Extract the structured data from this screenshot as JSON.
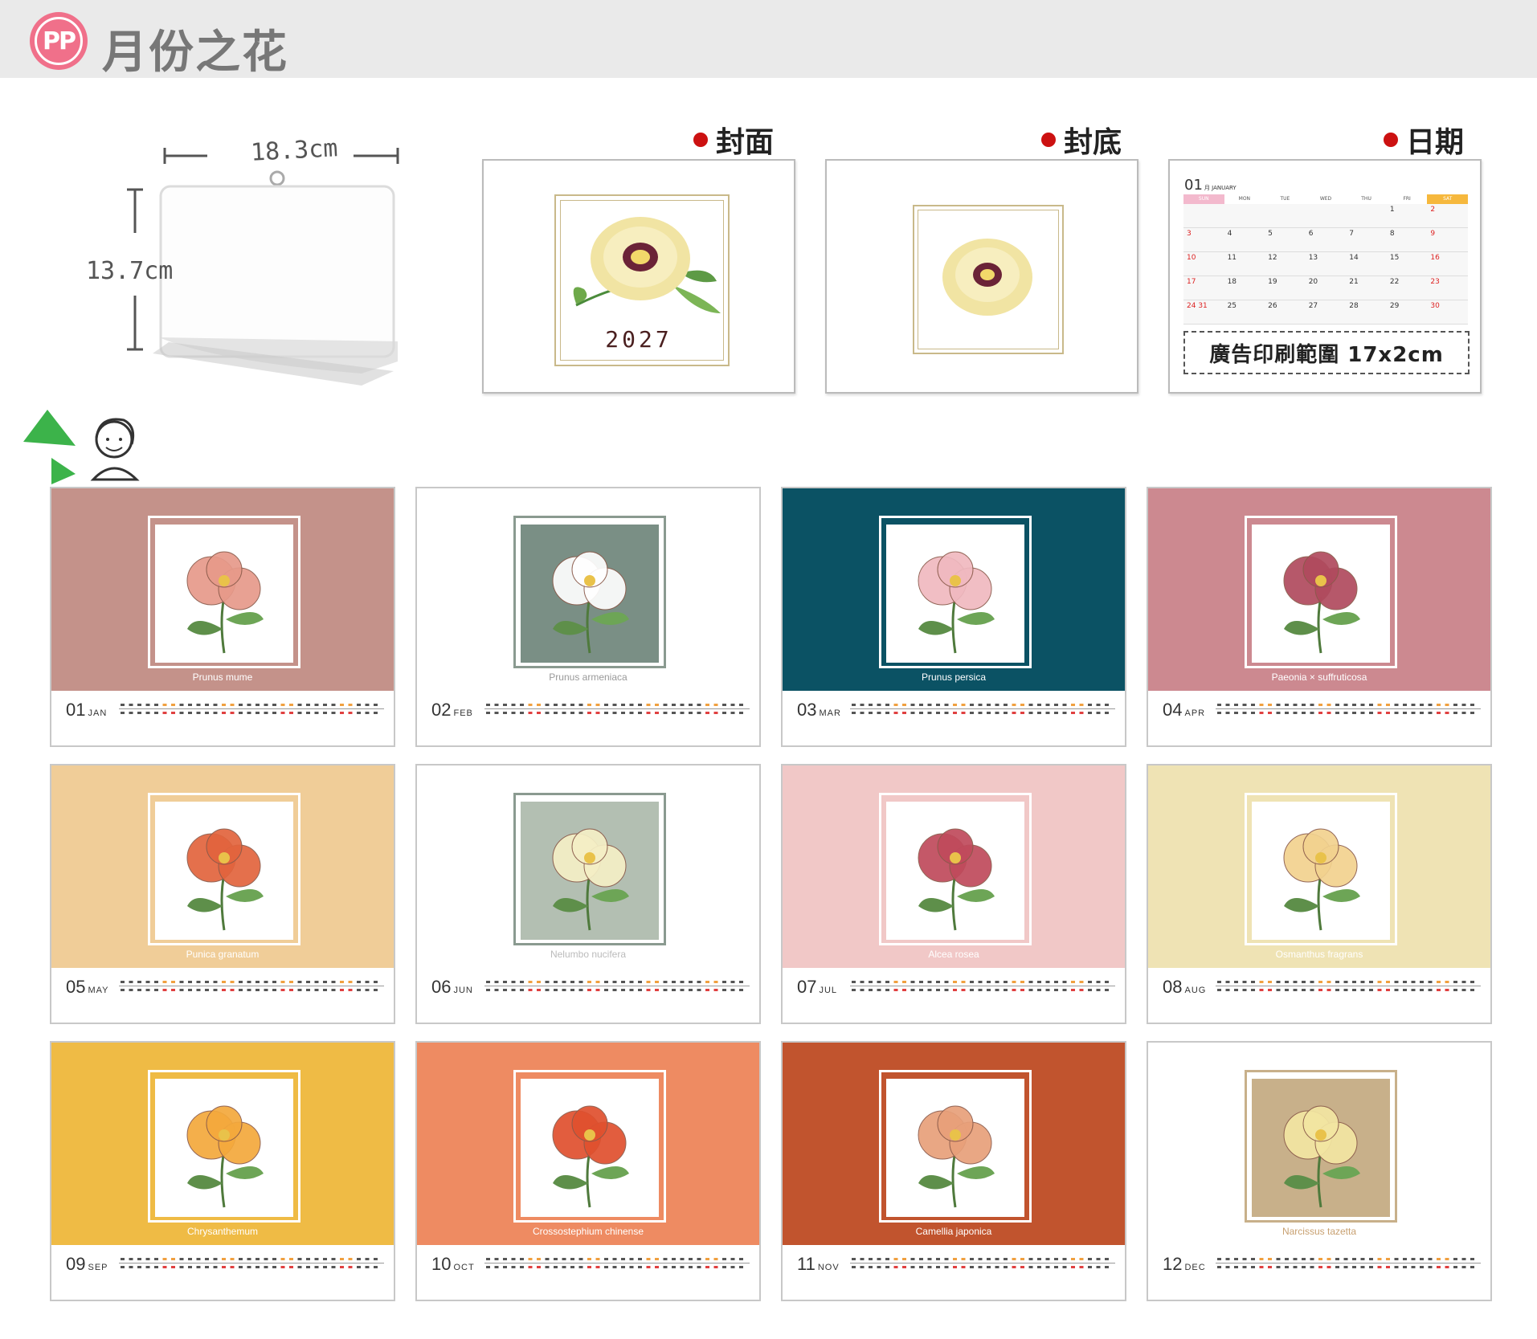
{
  "header": {
    "logo_text": "PP",
    "title": "月份之花"
  },
  "dimensions": {
    "width_label": "18.3cm",
    "height_label": "13.7cm"
  },
  "samples": {
    "cover_label": "封面",
    "back_label": "封底",
    "date_label": "日期",
    "cover_year": "2027",
    "date_sample": {
      "month_num": "01",
      "month_en": "月 JANUARY",
      "weekdays": [
        "SUN",
        "MON",
        "TUE",
        "WED",
        "THU",
        "FRI",
        "SAT"
      ],
      "days": [
        "",
        "",
        "",
        "",
        "",
        "1",
        "2",
        "3",
        "4",
        "5",
        "6",
        "7",
        "8",
        "9",
        "10",
        "11",
        "12",
        "13",
        "14",
        "15",
        "16",
        "17",
        "18",
        "19",
        "20",
        "21",
        "22",
        "23",
        "24 31",
        "25",
        "26",
        "27",
        "28",
        "29",
        "30"
      ],
      "ad_text": "廣告印刷範圍 17x2cm"
    }
  },
  "months": [
    {
      "num": "01",
      "abbr": "JAN",
      "flower": "Prunus mume",
      "bg": "#c4928a"
    },
    {
      "num": "02",
      "abbr": "FEB",
      "flower": "Prunus armeniaca",
      "bg": "#ffffff"
    },
    {
      "num": "03",
      "abbr": "MAR",
      "flower": "Prunus persica",
      "bg": "#0b5264"
    },
    {
      "num": "04",
      "abbr": "APR",
      "flower": "Paeonia × suffruticosa",
      "bg": "#cc8990"
    },
    {
      "num": "05",
      "abbr": "MAY",
      "flower": "Punica granatum",
      "bg": "#f0cd98"
    },
    {
      "num": "06",
      "abbr": "JUN",
      "flower": "Nelumbo nucifera",
      "bg": "#ffffff"
    },
    {
      "num": "07",
      "abbr": "JUL",
      "flower": "Alcea rosea",
      "bg": "#f1c8c7"
    },
    {
      "num": "08",
      "abbr": "AUG",
      "flower": "Osmanthus fragrans",
      "bg": "#efe3b4"
    },
    {
      "num": "09",
      "abbr": "SEP",
      "flower": "Chrysanthemum",
      "bg": "#efbb45"
    },
    {
      "num": "10",
      "abbr": "OCT",
      "flower": "Crossostephium chinense",
      "bg": "#ee8b62"
    },
    {
      "num": "11",
      "abbr": "NOV",
      "flower": "Camellia japonica",
      "bg": "#c1542e"
    },
    {
      "num": "12",
      "abbr": "DEC",
      "flower": "Narcissus tazetta",
      "bg": "#ffffff"
    }
  ]
}
